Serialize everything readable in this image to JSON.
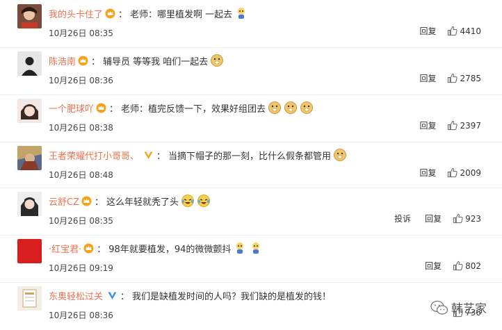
{
  "reply_label": "回复",
  "report_label": "投诉",
  "watermark": "韩艺家",
  "comments": [
    {
      "name": "我的头卡住了",
      "text": "老师：哪里植发啊 一起去",
      "time": "10月26日 08:35",
      "likes": "4410"
    },
    {
      "name": "陈浩南",
      "text": "辅导员 等等我 咱们一起去",
      "time": "10月26日 08:36",
      "likes": "2785"
    },
    {
      "name": "一个肥球吖",
      "text": "老师：植完反馈一下，效果好组团去",
      "time": "10月26日 08:38",
      "likes": "2397"
    },
    {
      "name": "王者荣耀代打小哥哥、",
      "text": "当摘下帽子的那一刻，比什么假条都管用",
      "time": "10月26日 08:48",
      "likes": "2009"
    },
    {
      "name": "云舒CZ",
      "text": "这么年轻就秃了头",
      "time": "10月26日 08:35",
      "likes": "923"
    },
    {
      "name": "·红宝君·",
      "text": "98年就要植发，94的微微颤抖",
      "time": "10月26日 09:19",
      "likes": "802"
    },
    {
      "name": "东奥轻松过关",
      "text": "我们是缺植发时间的人吗？我们缺的是植发的钱！",
      "time": "10月26日 08:36",
      "likes": "736"
    }
  ]
}
